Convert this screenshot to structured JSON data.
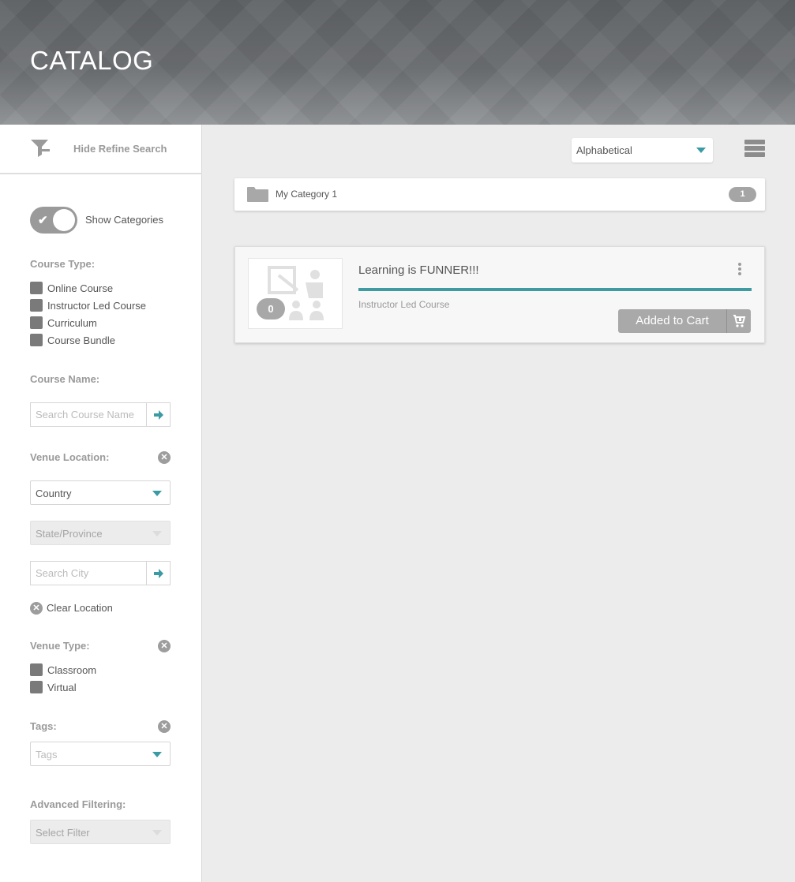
{
  "header": {
    "title": "CATALOG"
  },
  "sidebar": {
    "refine_toggle_label": "Hide Refine Search",
    "show_categories_label": "Show Categories",
    "course_type": {
      "label": "Course Type:",
      "options": [
        "Online Course",
        "Instructor Led Course",
        "Curriculum",
        "Course Bundle"
      ]
    },
    "course_name": {
      "label": "Course Name:",
      "placeholder": "Search Course Name"
    },
    "venue_location": {
      "label": "Venue Location:",
      "country": "Country",
      "state": "State/Province",
      "city_placeholder": "Search City",
      "clear_label": "Clear Location"
    },
    "venue_type": {
      "label": "Venue Type:",
      "options": [
        "Classroom",
        "Virtual"
      ]
    },
    "tags": {
      "label": "Tags:",
      "placeholder": "Tags"
    },
    "advanced": {
      "label": "Advanced Filtering:",
      "placeholder": "Select Filter"
    }
  },
  "main": {
    "sort": {
      "selected": "Alphabetical"
    },
    "category": {
      "name": "My Category 1",
      "count": "1"
    },
    "course": {
      "title": "Learning is FUNNER!!!",
      "type": "Instructor Led Course",
      "thumb_count": "0",
      "cart_label": "Added to Cart"
    }
  },
  "colors": {
    "accent": "#3f9ba2",
    "header_bg": "#6d7073",
    "button_gray": "#a9a9a9"
  }
}
